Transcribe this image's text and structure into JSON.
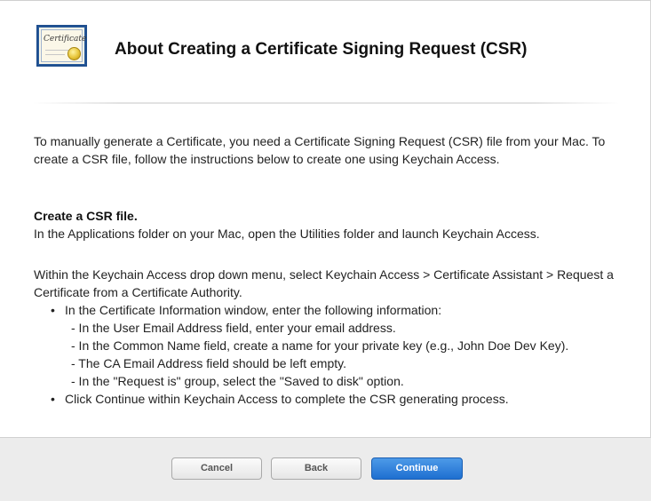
{
  "header": {
    "icon": "certificate-icon",
    "icon_text": "Certificate",
    "title": "About Creating a Certificate Signing Request (CSR)"
  },
  "body": {
    "intro": "To manually generate a Certificate, you need a Certificate Signing Request (CSR) file from your Mac. To create a CSR file, follow the instructions below to create one using Keychain Access.",
    "section_title": "Create a CSR file.",
    "section_line": "In the Applications folder on your Mac, open the Utilities folder and launch Keychain Access.",
    "menu_para": "Within the Keychain Access drop down menu, select Keychain Access > Certificate Assistant > Request a Certificate from a Certificate Authority.",
    "bullets": [
      {
        "text": "In the Certificate Information window, enter the following information:",
        "sub": [
          "- In the User Email Address field, enter your email address.",
          "- In the Common Name field, create a name for your private key (e.g., John Doe Dev Key).",
          "- The CA Email Address field should be left empty.",
          "- In the \"Request is\" group, select the \"Saved to disk\" option."
        ]
      },
      {
        "text": "Click Continue within Keychain Access to complete the CSR generating process.",
        "sub": []
      }
    ],
    "bullet_char": "•"
  },
  "footer": {
    "cancel_label": "Cancel",
    "back_label": "Back",
    "continue_label": "Continue"
  },
  "colors": {
    "primary_button": "#1e6fd0",
    "footer_bg": "#ececec"
  }
}
